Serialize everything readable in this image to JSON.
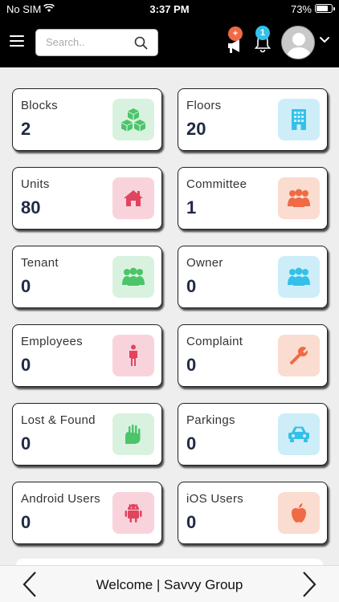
{
  "status_bar": {
    "carrier": "No SIM",
    "time": "3:37 PM",
    "battery": "73%"
  },
  "header": {
    "search_placeholder": "Search..",
    "announcement_badge": "+",
    "notification_badge": "1"
  },
  "cards": [
    {
      "label": "Blocks",
      "count": "2",
      "icon": "cubes-icon",
      "bg": "#d9f2df",
      "fg": "#4cc46a"
    },
    {
      "label": "Floors",
      "count": "20",
      "icon": "building-icon",
      "bg": "#cdeef8",
      "fg": "#34c0e8"
    },
    {
      "label": "Units",
      "count": "80",
      "icon": "home-icon",
      "bg": "#f9d3dc",
      "fg": "#e0445f"
    },
    {
      "label": "Committee",
      "count": "1",
      "icon": "group-icon",
      "bg": "#fbdcd0",
      "fg": "#f06a45"
    },
    {
      "label": "Tenant",
      "count": "0",
      "icon": "users-icon",
      "bg": "#d9f2df",
      "fg": "#4cc46a"
    },
    {
      "label": "Owner",
      "count": "0",
      "icon": "users-icon",
      "bg": "#cdeef8",
      "fg": "#34c0e8"
    },
    {
      "label": "Employees",
      "count": "0",
      "icon": "person-icon",
      "bg": "#f9d3dc",
      "fg": "#e0445f"
    },
    {
      "label": "Complaint",
      "count": "0",
      "icon": "wrench-icon",
      "bg": "#fbdcd0",
      "fg": "#f06a45"
    },
    {
      "label": "Lost & Found",
      "count": "0",
      "icon": "hand-icon",
      "bg": "#d9f2df",
      "fg": "#4cc46a"
    },
    {
      "label": "Parkings",
      "count": "0",
      "icon": "car-icon",
      "bg": "#cdeef8",
      "fg": "#34c0e8"
    },
    {
      "label": "Android Users",
      "count": "0",
      "icon": "android-icon",
      "bg": "#f9d3dc",
      "fg": "#e0445f"
    },
    {
      "label": "iOS Users",
      "count": "0",
      "icon": "apple-icon",
      "bg": "#fbdcd0",
      "fg": "#f06a45"
    }
  ],
  "footer": {
    "ticker": "Welcome | Savvy Group"
  },
  "colors": {
    "header_bg": "#000000",
    "announcement_badge": "#f06a45",
    "notification_badge": "#34c0e8",
    "count_text": "#1f2a44"
  }
}
